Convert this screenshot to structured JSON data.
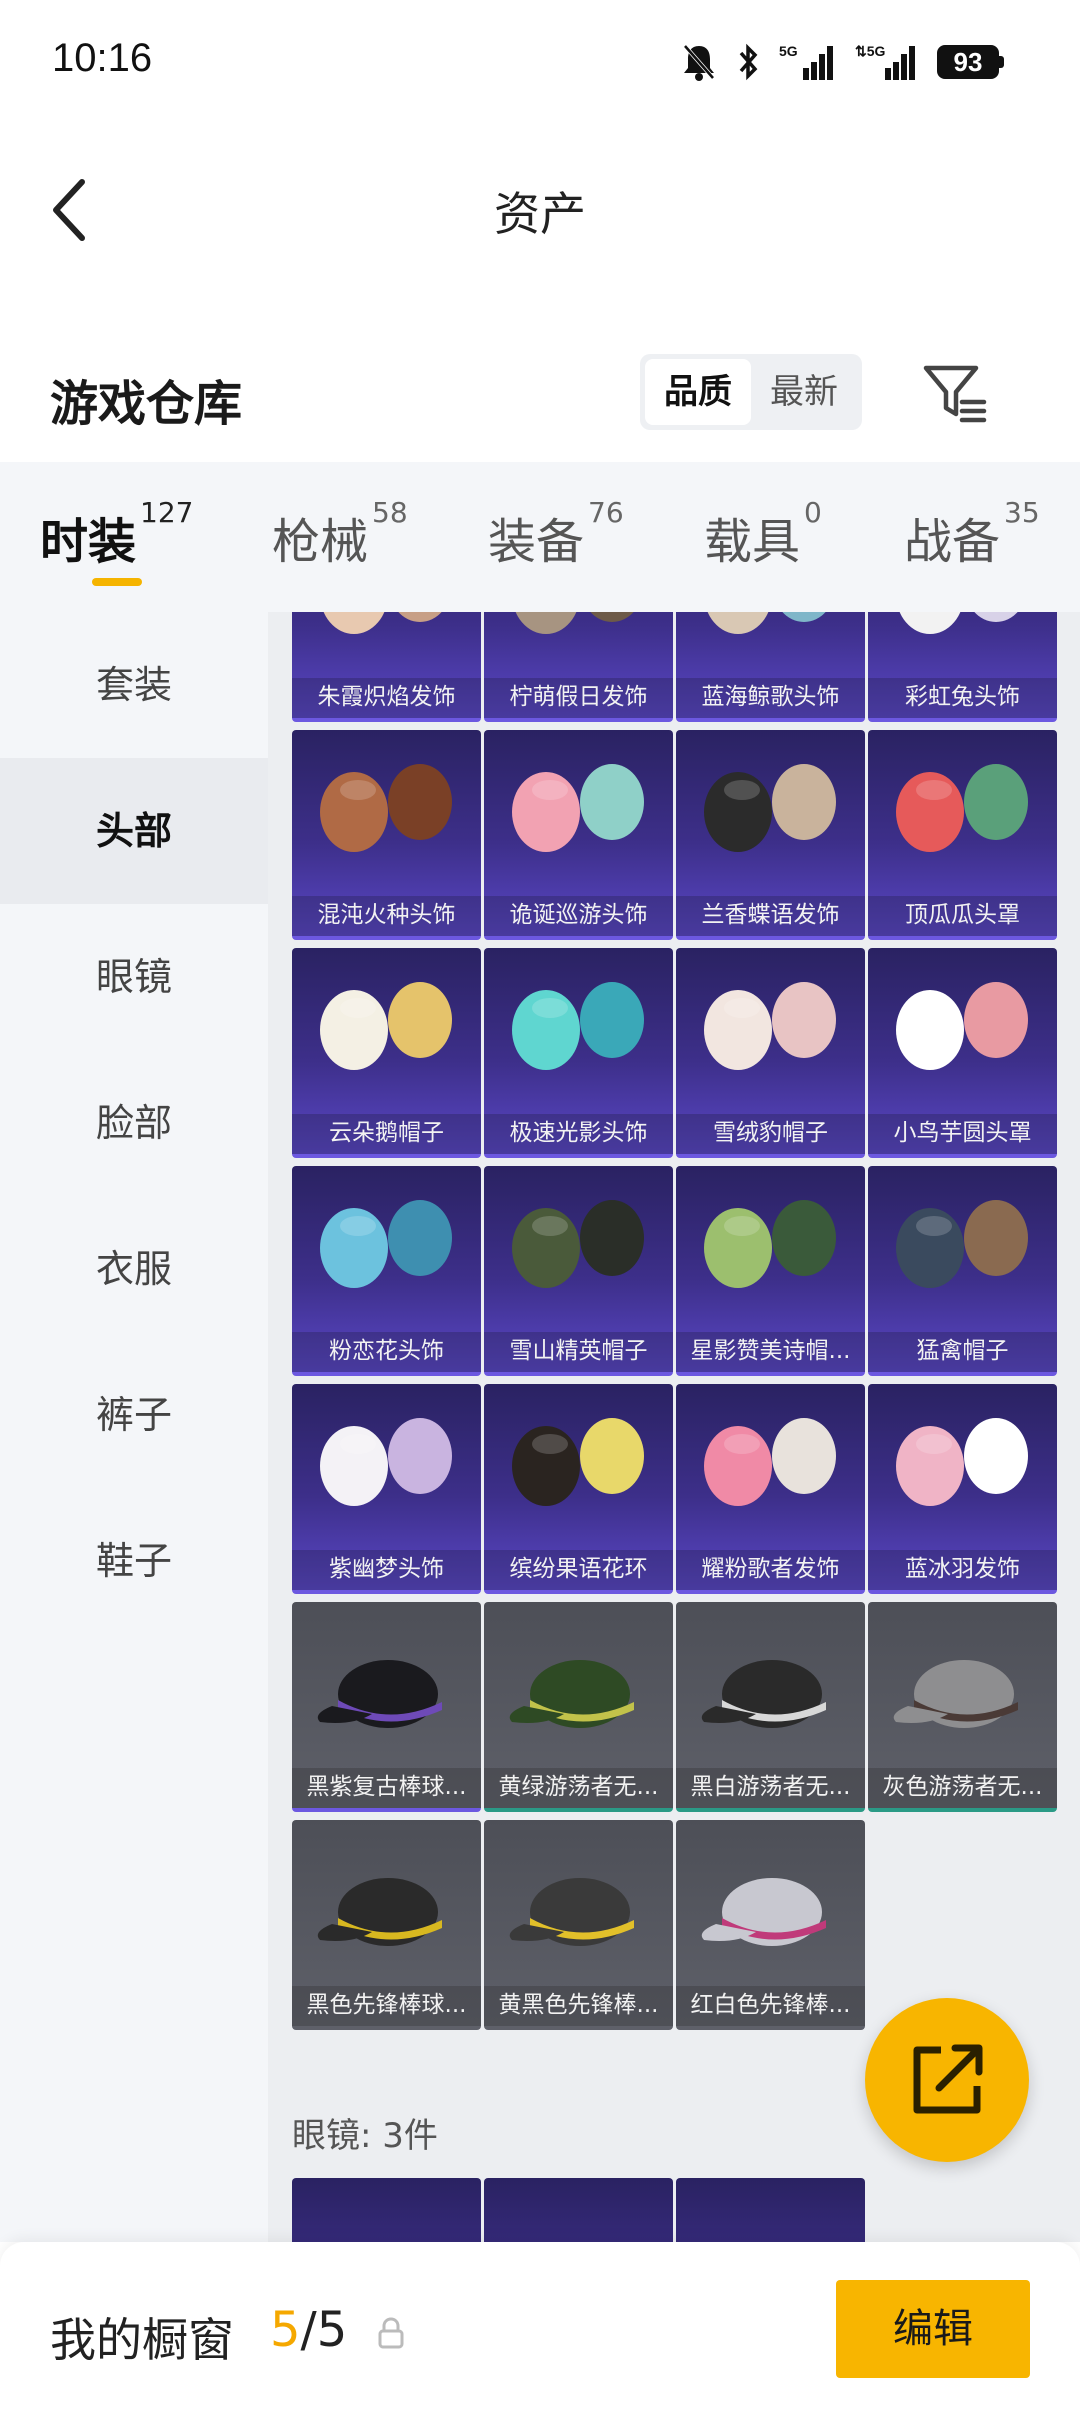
{
  "status_bar": {
    "time": "10:16",
    "battery": "93",
    "network_1": "5G",
    "network_2": "5G"
  },
  "header": {
    "title": "资产",
    "back_icon": "chevron-left-icon"
  },
  "section": {
    "title": "游戏仓库",
    "sort_options": [
      "品质",
      "最新"
    ],
    "sort_active": "品质",
    "filter_icon": "filter-icon"
  },
  "tabs": [
    {
      "label": "时装",
      "count": "127",
      "active": true
    },
    {
      "label": "枪械",
      "count": "58",
      "active": false
    },
    {
      "label": "装备",
      "count": "76",
      "active": false
    },
    {
      "label": "载具",
      "count": "0",
      "active": false
    },
    {
      "label": "战备",
      "count": "35",
      "active": false
    }
  ],
  "sidebar": {
    "items": [
      {
        "label": "套装",
        "active": false
      },
      {
        "label": "头部",
        "active": true
      },
      {
        "label": "眼镜",
        "active": false
      },
      {
        "label": "脸部",
        "active": false
      },
      {
        "label": "衣服",
        "active": false
      },
      {
        "label": "裤子",
        "active": false
      },
      {
        "label": "鞋子",
        "active": false
      }
    ]
  },
  "items": [
    {
      "name": "朱霞炽焰发饰",
      "rarity": "purple"
    },
    {
      "name": "柠萌假日发饰",
      "rarity": "purple"
    },
    {
      "name": "蓝海鲸歌头饰",
      "rarity": "purple"
    },
    {
      "name": "彩虹兔头饰",
      "rarity": "purple"
    },
    {
      "name": "混沌火种头饰",
      "rarity": "purple"
    },
    {
      "name": "诡诞巡游头饰",
      "rarity": "purple"
    },
    {
      "name": "兰香蝶语发饰",
      "rarity": "purple"
    },
    {
      "name": "顶瓜瓜头罩",
      "rarity": "purple"
    },
    {
      "name": "云朵鹅帽子",
      "rarity": "purple"
    },
    {
      "name": "极速光影头饰",
      "rarity": "purple"
    },
    {
      "name": "雪绒豹帽子",
      "rarity": "purple"
    },
    {
      "name": "小鸟芋圆头罩",
      "rarity": "purple"
    },
    {
      "name": "粉恋花头饰",
      "rarity": "purple"
    },
    {
      "name": "雪山精英帽子",
      "rarity": "purple"
    },
    {
      "name": "星影赞美诗帽...",
      "rarity": "purple"
    },
    {
      "name": "猛禽帽子",
      "rarity": "purple"
    },
    {
      "name": "紫幽梦头饰",
      "rarity": "purple"
    },
    {
      "name": "缤纷果语花环",
      "rarity": "purple"
    },
    {
      "name": "耀粉歌者发饰",
      "rarity": "purple"
    },
    {
      "name": "蓝冰羽发饰",
      "rarity": "purple"
    },
    {
      "name": "黑紫复古棒球...",
      "rarity": "gray-purple"
    },
    {
      "name": "黄绿游荡者无...",
      "rarity": "gray-teal"
    },
    {
      "name": "黑白游荡者无...",
      "rarity": "gray-teal"
    },
    {
      "name": "灰色游荡者无...",
      "rarity": "gray-teal"
    },
    {
      "name": "黑色先锋棒球...",
      "rarity": "gray"
    },
    {
      "name": "黄黑色先锋棒...",
      "rarity": "gray"
    },
    {
      "name": "红白色先锋棒...",
      "rarity": "gray"
    }
  ],
  "glasses_section": {
    "label": "眼镜: 3件"
  },
  "share_button": {
    "icon": "share-icon"
  },
  "showcase": {
    "label": "我的橱窗",
    "current": "5",
    "separator": "/",
    "total": "5",
    "lock_icon": "lock-icon"
  },
  "edit_button": {
    "label": "编辑"
  },
  "colors": {
    "accent": "#f8b500",
    "purple_rarity": "#6c58e0",
    "teal_rarity": "#2a9a86"
  }
}
